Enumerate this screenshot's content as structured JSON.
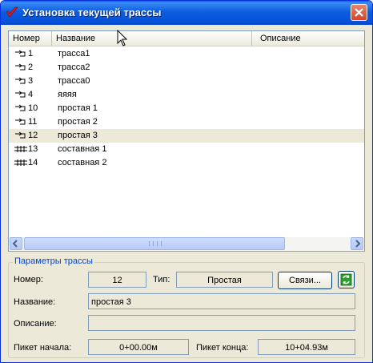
{
  "window": {
    "title": "Установка текущей трассы",
    "close_icon": "close-icon",
    "app_icon": "checkmark-app-icon"
  },
  "list": {
    "columns": [
      "Номер",
      "Название",
      "Описание"
    ],
    "rows": [
      {
        "number": "1",
        "name": "трасса1",
        "icon": "simple-route-icon",
        "selected": false
      },
      {
        "number": "2",
        "name": "трасса2",
        "icon": "simple-route-icon",
        "selected": false
      },
      {
        "number": "3",
        "name": "трасса0",
        "icon": "simple-route-icon",
        "selected": false
      },
      {
        "number": "4",
        "name": "яяяя",
        "icon": "simple-route-icon",
        "selected": false
      },
      {
        "number": "10",
        "name": "простая 1",
        "icon": "simple-route-icon",
        "selected": false
      },
      {
        "number": "11",
        "name": "простая 2",
        "icon": "simple-route-icon",
        "selected": false
      },
      {
        "number": "12",
        "name": "простая 3",
        "icon": "simple-route-icon",
        "selected": true
      },
      {
        "number": "13",
        "name": "составная 1",
        "icon": "composite-route-icon",
        "selected": false
      },
      {
        "number": "14",
        "name": "составная 2",
        "icon": "composite-route-icon",
        "selected": false
      }
    ]
  },
  "params": {
    "legend": "Параметры трассы",
    "number_label": "Номер:",
    "number_value": "12",
    "type_label": "Тип:",
    "type_value": "Простая",
    "links_button": "Связи...",
    "refresh_icon": "refresh-icon",
    "name_label": "Название:",
    "name_value": "простая 3",
    "description_label": "Описание:",
    "description_value": "",
    "start_label": "Пикет начала:",
    "start_value": "0+00.00м",
    "end_label": "Пикет конца:",
    "end_value": "10+04.93м"
  },
  "colors": {
    "titlebar": "#0551d8",
    "accent": "#0046d5",
    "close": "#d2442a"
  }
}
